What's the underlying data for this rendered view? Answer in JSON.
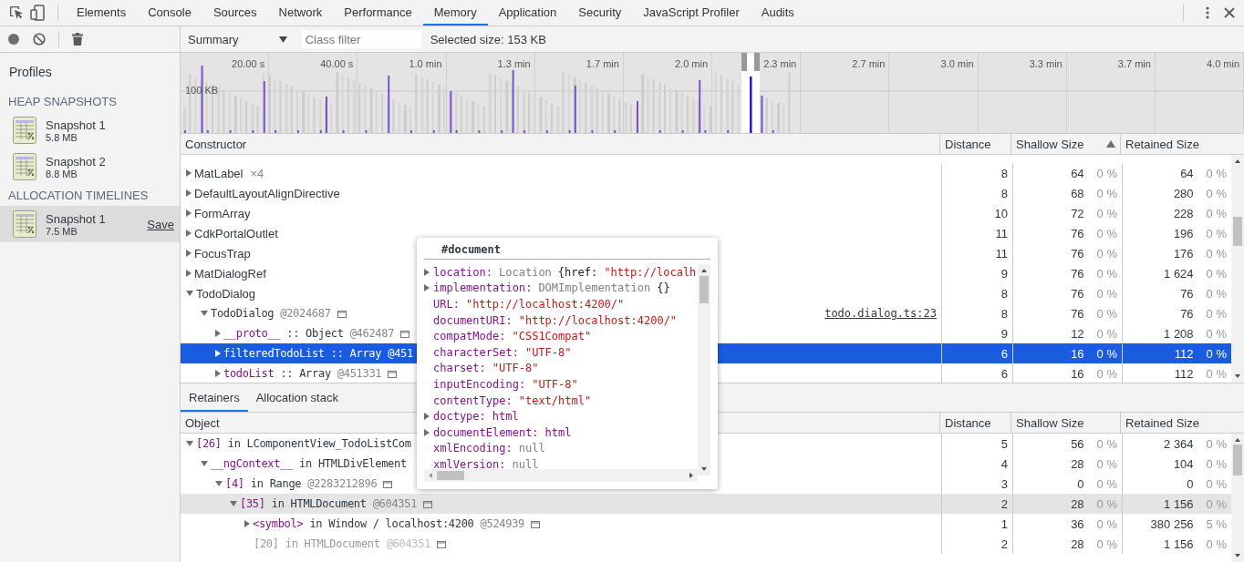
{
  "tabs": [
    {
      "label": "Elements",
      "selected": false
    },
    {
      "label": "Console",
      "selected": false
    },
    {
      "label": "Sources",
      "selected": false
    },
    {
      "label": "Network",
      "selected": false
    },
    {
      "label": "Performance",
      "selected": false
    },
    {
      "label": "Memory",
      "selected": true
    },
    {
      "label": "Application",
      "selected": false
    },
    {
      "label": "Security",
      "selected": false
    },
    {
      "label": "JavaScript Profiler",
      "selected": false
    },
    {
      "label": "Audits",
      "selected": false
    }
  ],
  "sidebar": {
    "title": "Profiles",
    "sections": [
      {
        "heading": "HEAP SNAPSHOTS",
        "items": [
          {
            "name": "Snapshot 1",
            "size": "5.8 MB",
            "selected": false
          },
          {
            "name": "Snapshot 2",
            "size": "8.8 MB",
            "selected": false
          }
        ]
      },
      {
        "heading": "ALLOCATION TIMELINES",
        "items": [
          {
            "name": "Snapshot 1",
            "size": "7.5 MB",
            "selected": true,
            "action": "Save"
          }
        ]
      }
    ]
  },
  "toolbar": {
    "view": "Summary",
    "filter_placeholder": "Class filter",
    "selected_size": "Selected size: 153 KB"
  },
  "overview": {
    "ticks": [
      "20.00 s",
      "40.00 s",
      "1.0 min",
      "1.3 min",
      "1.7 min",
      "2.0 min",
      "2.3 min",
      "2.7 min",
      "3.0 min",
      "3.3 min",
      "3.7 min",
      "4.0 min"
    ],
    "scale_label": "100 KB"
  },
  "constructors": {
    "columns": [
      {
        "label": "Constructor",
        "sorted": false
      },
      {
        "label": "Distance",
        "sorted": false
      },
      {
        "label": "Shallow Size",
        "sorted": true
      },
      {
        "label": "Retained Size",
        "sorted": false
      }
    ],
    "rows": [
      {
        "kind": "class",
        "name": "MatLabel",
        "count": "×4",
        "distance": "8",
        "shallow": "64",
        "shallow_pct": "0 %",
        "retained": "64",
        "retained_pct": "0 %",
        "expanded": false,
        "selected": false
      },
      {
        "kind": "class",
        "name": "DefaultLayoutAlignDirective",
        "distance": "8",
        "shallow": "68",
        "shallow_pct": "0 %",
        "retained": "280",
        "retained_pct": "0 %",
        "expanded": false,
        "selected": false
      },
      {
        "kind": "class",
        "name": "FormArray",
        "distance": "10",
        "shallow": "72",
        "shallow_pct": "0 %",
        "retained": "228",
        "retained_pct": "0 %",
        "expanded": false,
        "selected": false
      },
      {
        "kind": "class",
        "name": "CdkPortalOutlet",
        "distance": "11",
        "shallow": "76",
        "shallow_pct": "0 %",
        "retained": "196",
        "retained_pct": "0 %",
        "expanded": false,
        "selected": false
      },
      {
        "kind": "class",
        "name": "FocusTrap",
        "distance": "11",
        "shallow": "76",
        "shallow_pct": "0 %",
        "retained": "176",
        "retained_pct": "0 %",
        "expanded": false,
        "selected": false
      },
      {
        "kind": "class",
        "name": "MatDialogRef",
        "distance": "9",
        "shallow": "76",
        "shallow_pct": "0 %",
        "retained": "1 624",
        "retained_pct": "0 %",
        "expanded": false,
        "selected": false
      },
      {
        "kind": "class",
        "name": "TodoDialog",
        "distance": "8",
        "shallow": "76",
        "shallow_pct": "0 %",
        "retained": "76",
        "retained_pct": "0 %",
        "expanded": true,
        "selected": false,
        "children": [
          {
            "kind": "object",
            "name": "TodoDialog",
            "id": "@2024687",
            "link": "todo.dialog.ts:23",
            "distance": "8",
            "shallow": "76",
            "shallow_pct": "0 %",
            "retained": "76",
            "retained_pct": "0 %",
            "expanded": true,
            "selected": false,
            "children": [
              {
                "kind": "property",
                "name": "__proto__",
                "type": ":: Object",
                "id": "@462487",
                "distance": "9",
                "shallow": "12",
                "shallow_pct": "0 %",
                "retained": "1 208",
                "retained_pct": "0 %",
                "expanded": false,
                "selected": false
              },
              {
                "kind": "property",
                "name": "filteredTodoList",
                "type": ":: Array",
                "id": "@451",
                "distance": "6",
                "shallow": "16",
                "shallow_pct": "0 %",
                "retained": "112",
                "retained_pct": "0 %",
                "expanded": false,
                "selected": true
              },
              {
                "kind": "property",
                "name": "todoList",
                "type": ":: Array",
                "id": "@451331",
                "distance": "6",
                "shallow": "16",
                "shallow_pct": "0 %",
                "retained": "112",
                "retained_pct": "0 %",
                "expanded": false,
                "selected": false
              }
            ]
          }
        ]
      }
    ]
  },
  "bottom_tabs": [
    {
      "label": "Retainers",
      "selected": true
    },
    {
      "label": "Allocation stack",
      "selected": false
    }
  ],
  "retainers": {
    "columns": [
      {
        "label": "Object"
      },
      {
        "label": "Distance"
      },
      {
        "label": "Shallow Size"
      },
      {
        "label": "Retained Size"
      }
    ],
    "rows": [
      {
        "index": "[26]",
        "relation": "in",
        "holder": "LComponentView_TodoListCom",
        "distance": "5",
        "shallow": "56",
        "shallow_pct": "0 %",
        "retained": "2 364",
        "retained_pct": "0 %",
        "expandable": true,
        "expanded": true,
        "selected": false,
        "dimmed": false,
        "children": [
          {
            "index": "__ngContext__",
            "relation": "in",
            "holder": "HTMLDivElement",
            "distance": "4",
            "shallow": "28",
            "shallow_pct": "0 %",
            "retained": "104",
            "retained_pct": "0 %",
            "expandable": true,
            "expanded": true,
            "selected": false,
            "dimmed": false,
            "children": [
              {
                "index": "[4]",
                "relation": "in",
                "holder": "Range",
                "id": "@2283212896",
                "distance": "3",
                "shallow": "0",
                "shallow_pct": "0 %",
                "retained": "0",
                "retained_pct": "0 %",
                "expandable": true,
                "expanded": true,
                "selected": false,
                "dimmed": false,
                "children": [
                  {
                    "index": "[35]",
                    "relation": "in",
                    "holder": "HTMLDocument",
                    "id": "@604351",
                    "distance": "2",
                    "shallow": "28",
                    "shallow_pct": "0 %",
                    "retained": "1 156",
                    "retained_pct": "0 %",
                    "expandable": true,
                    "expanded": true,
                    "selected": true,
                    "dimmed": false,
                    "children": [
                      {
                        "index": "<symbol>",
                        "relation": "in",
                        "holder": "Window / localhost:4200",
                        "id": "@524939",
                        "distance": "1",
                        "shallow": "36",
                        "shallow_pct": "0 %",
                        "retained": "380 256",
                        "retained_pct": "5 %",
                        "expandable": true,
                        "expanded": false,
                        "selected": false,
                        "dimmed": false
                      },
                      {
                        "index": "[20]",
                        "relation": "in",
                        "holder": "HTMLDocument",
                        "id": "@604351",
                        "distance": "2",
                        "shallow": "28",
                        "shallow_pct": "0 %",
                        "retained": "1 156",
                        "retained_pct": "0 %",
                        "expandable": false,
                        "selected": false,
                        "dimmed": true
                      }
                    ]
                  }
                ]
              }
            ]
          }
        ]
      }
    ]
  },
  "popover": {
    "title": "#document",
    "properties": [
      {
        "key": "location:",
        "expandable": true,
        "parts": [
          {
            "text": "Location",
            "kind": "type"
          },
          {
            "text": "{href:",
            "kind": "plain"
          },
          {
            "text": "\"http://localh",
            "kind": "string"
          }
        ]
      },
      {
        "key": "implementation:",
        "expandable": true,
        "parts": [
          {
            "text": "DOMImplementation",
            "kind": "type"
          },
          {
            "text": "{}",
            "kind": "plain"
          }
        ]
      },
      {
        "key": "URL:",
        "expandable": false,
        "parts": [
          {
            "text": "\"http://localhost:4200/\"",
            "kind": "string"
          }
        ]
      },
      {
        "key": "documentURI:",
        "expandable": false,
        "parts": [
          {
            "text": "\"http://localhost:4200/\"",
            "kind": "string"
          }
        ]
      },
      {
        "key": "compatMode:",
        "expandable": false,
        "parts": [
          {
            "text": "\"CSS1Compat\"",
            "kind": "string"
          }
        ]
      },
      {
        "key": "characterSet:",
        "expandable": false,
        "parts": [
          {
            "text": "\"UTF-8\"",
            "kind": "string"
          }
        ]
      },
      {
        "key": "charset:",
        "expandable": false,
        "parts": [
          {
            "text": "\"UTF-8\"",
            "kind": "string"
          }
        ]
      },
      {
        "key": "inputEncoding:",
        "expandable": false,
        "parts": [
          {
            "text": "\"UTF-8\"",
            "kind": "string"
          }
        ]
      },
      {
        "key": "contentType:",
        "expandable": false,
        "parts": [
          {
            "text": "\"text/html\"",
            "kind": "string"
          }
        ]
      },
      {
        "key": "doctype:",
        "expandable": true,
        "parts": [
          {
            "text": "html",
            "kind": "node"
          }
        ]
      },
      {
        "key": "documentElement:",
        "expandable": true,
        "parts": [
          {
            "text": "html",
            "kind": "node"
          }
        ]
      },
      {
        "key": "xmlEncoding:",
        "expandable": false,
        "parts": [
          {
            "text": "null",
            "kind": "null"
          }
        ]
      },
      {
        "key": "xmlVersion:",
        "expandable": false,
        "parts": [
          {
            "text": "null",
            "kind": "null"
          }
        ]
      }
    ]
  }
}
